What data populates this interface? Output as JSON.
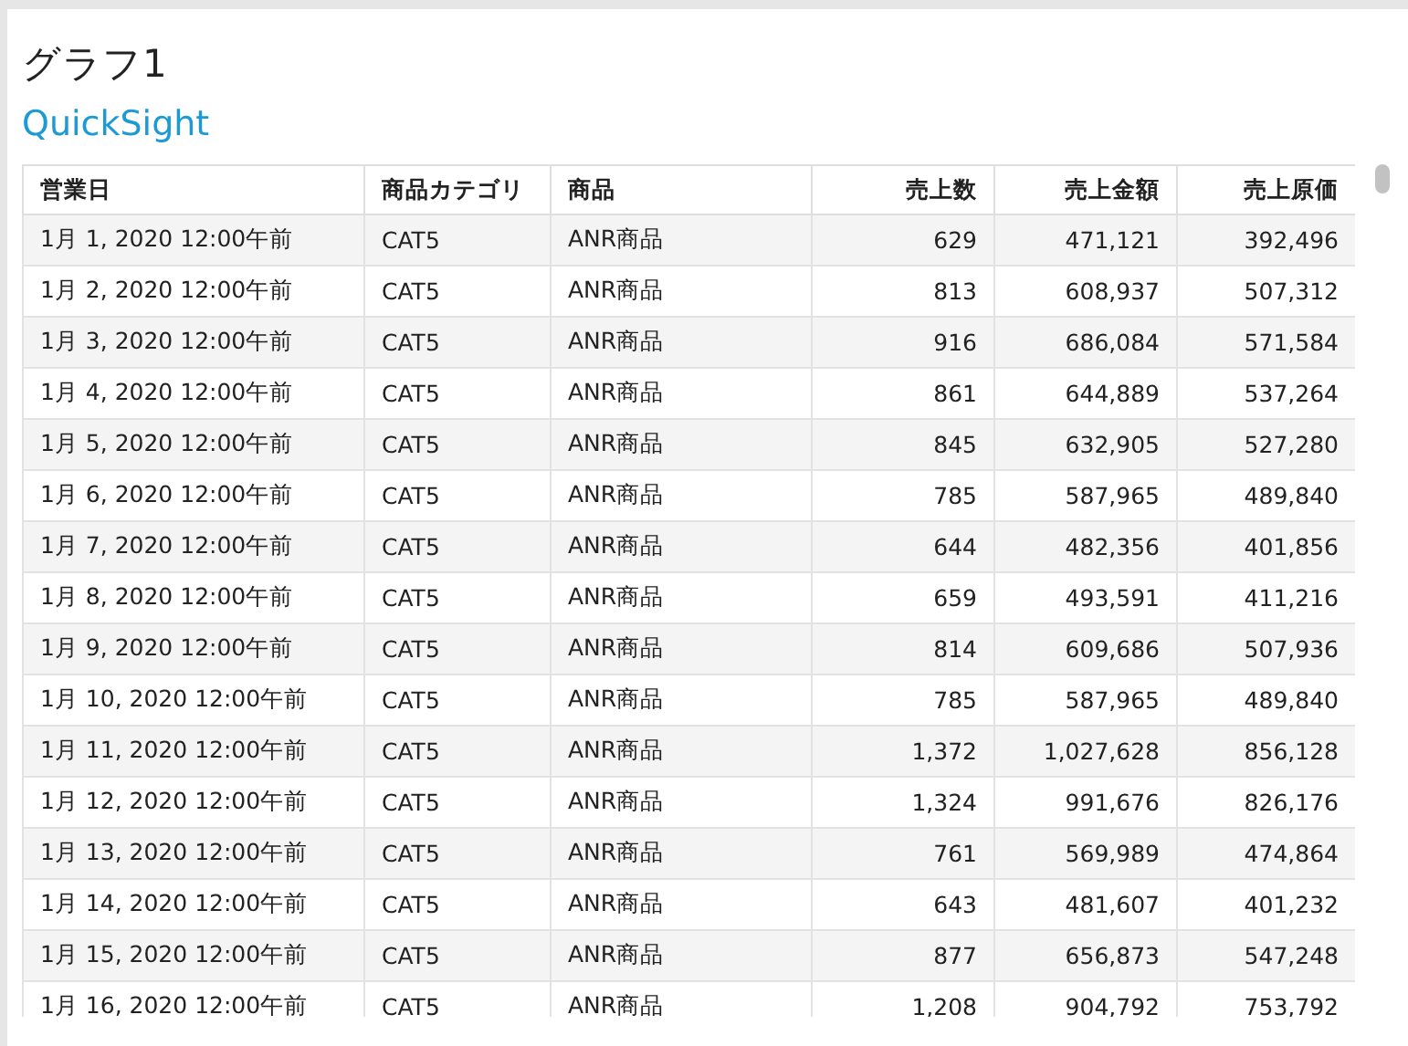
{
  "title": "グラフ1",
  "subtitle": "QuickSight",
  "table": {
    "columns": [
      {
        "label": "営業日",
        "kind": "text"
      },
      {
        "label": "商品カテゴリ",
        "kind": "text"
      },
      {
        "label": "商品",
        "kind": "text"
      },
      {
        "label": "売上数",
        "kind": "number"
      },
      {
        "label": "売上金額",
        "kind": "number"
      },
      {
        "label": "売上原価",
        "kind": "number"
      }
    ],
    "rows": [
      [
        "1月 1, 2020 12:00午前",
        "CAT5",
        "ANR商品",
        "629",
        "471,121",
        "392,496"
      ],
      [
        "1月 2, 2020 12:00午前",
        "CAT5",
        "ANR商品",
        "813",
        "608,937",
        "507,312"
      ],
      [
        "1月 3, 2020 12:00午前",
        "CAT5",
        "ANR商品",
        "916",
        "686,084",
        "571,584"
      ],
      [
        "1月 4, 2020 12:00午前",
        "CAT5",
        "ANR商品",
        "861",
        "644,889",
        "537,264"
      ],
      [
        "1月 5, 2020 12:00午前",
        "CAT5",
        "ANR商品",
        "845",
        "632,905",
        "527,280"
      ],
      [
        "1月 6, 2020 12:00午前",
        "CAT5",
        "ANR商品",
        "785",
        "587,965",
        "489,840"
      ],
      [
        "1月 7, 2020 12:00午前",
        "CAT5",
        "ANR商品",
        "644",
        "482,356",
        "401,856"
      ],
      [
        "1月 8, 2020 12:00午前",
        "CAT5",
        "ANR商品",
        "659",
        "493,591",
        "411,216"
      ],
      [
        "1月 9, 2020 12:00午前",
        "CAT5",
        "ANR商品",
        "814",
        "609,686",
        "507,936"
      ],
      [
        "1月 10, 2020 12:00午前",
        "CAT5",
        "ANR商品",
        "785",
        "587,965",
        "489,840"
      ],
      [
        "1月 11, 2020 12:00午前",
        "CAT5",
        "ANR商品",
        "1,372",
        "1,027,628",
        "856,128"
      ],
      [
        "1月 12, 2020 12:00午前",
        "CAT5",
        "ANR商品",
        "1,324",
        "991,676",
        "826,176"
      ],
      [
        "1月 13, 2020 12:00午前",
        "CAT5",
        "ANR商品",
        "761",
        "569,989",
        "474,864"
      ],
      [
        "1月 14, 2020 12:00午前",
        "CAT5",
        "ANR商品",
        "643",
        "481,607",
        "401,232"
      ],
      [
        "1月 15, 2020 12:00午前",
        "CAT5",
        "ANR商品",
        "877",
        "656,873",
        "547,248"
      ],
      [
        "1月 16, 2020 12:00午前",
        "CAT5",
        "ANR商品",
        "1,208",
        "904,792",
        "753,792"
      ]
    ]
  }
}
